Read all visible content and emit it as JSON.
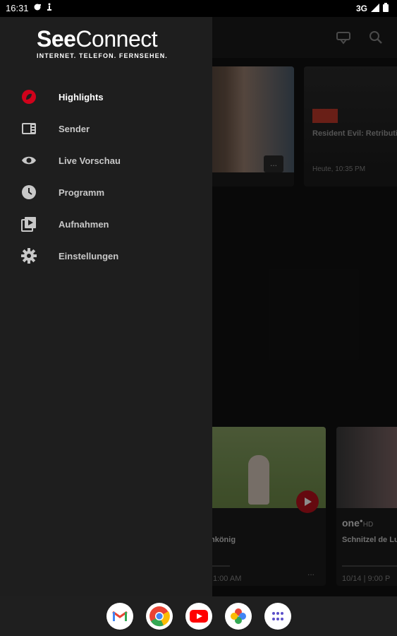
{
  "status_bar": {
    "time": "16:31",
    "network": "3G"
  },
  "drawer": {
    "logo": {
      "brand_bold": "See",
      "brand_regular": "Connect",
      "tagline": "INTERNET. TELEFON. FERNSEHEN."
    },
    "menu": [
      {
        "label": "Highlights",
        "icon": "highlights-icon",
        "active": true
      },
      {
        "label": "Sender",
        "icon": "channels-icon",
        "active": false
      },
      {
        "label": "Live Vorschau",
        "icon": "eye-icon",
        "active": false
      },
      {
        "label": "Programm",
        "icon": "clock-icon",
        "active": false
      },
      {
        "label": "Aufnahmen",
        "icon": "recordings-icon",
        "active": false
      },
      {
        "label": "Einstellungen",
        "icon": "gear-icon",
        "active": false
      }
    ]
  },
  "background": {
    "cards": [
      {
        "title": "Resident Evil: Retributi",
        "time": "Heute, 10:35 PM"
      },
      {
        "title": "hkönig",
        "time": "1:00 AM"
      },
      {
        "title": "Schnitzel de Lu",
        "time": "10/14 | 9:00 P",
        "channel": "one",
        "channel_suffix": "HD"
      }
    ],
    "more_label": "..."
  },
  "colors": {
    "accent": "#d0021b",
    "drawer_bg": "#1e1e1e",
    "app_bg": "#121212"
  }
}
